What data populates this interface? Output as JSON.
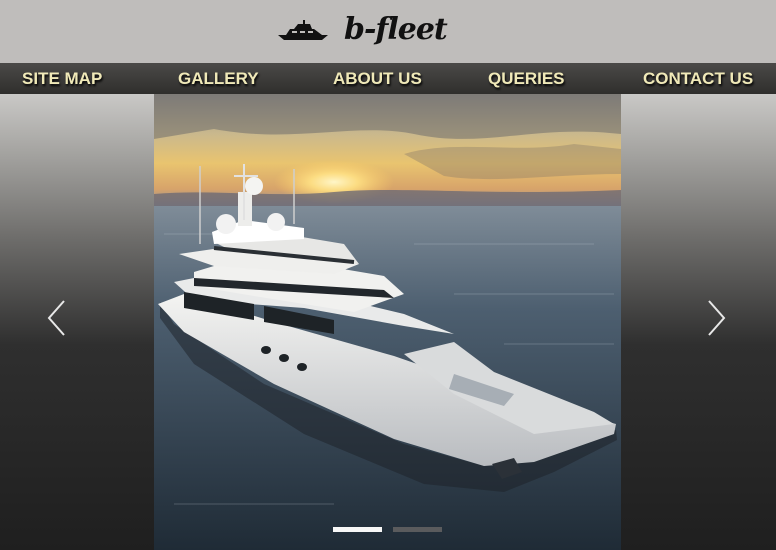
{
  "brand": {
    "name": "b-fleet",
    "logo_icon": "yacht-icon"
  },
  "nav": {
    "items": [
      {
        "label": "SITE MAP"
      },
      {
        "label": "GALLERY"
      },
      {
        "label": "ABOUT US"
      },
      {
        "label": "QUERIES"
      },
      {
        "label": "CONTACT US"
      }
    ]
  },
  "carousel": {
    "prev_icon": "chevron-left-icon",
    "next_icon": "chevron-right-icon",
    "slide_count": 2,
    "active_index": 0,
    "image_subject": "superyacht-at-sunset"
  },
  "colors": {
    "header_bg": "#bfbdbb",
    "nav_bg": "#3c3b39",
    "nav_text": "#f0e9b8",
    "indicator_active": "#f7f7f7",
    "indicator_inactive": "#5a5b5d"
  }
}
